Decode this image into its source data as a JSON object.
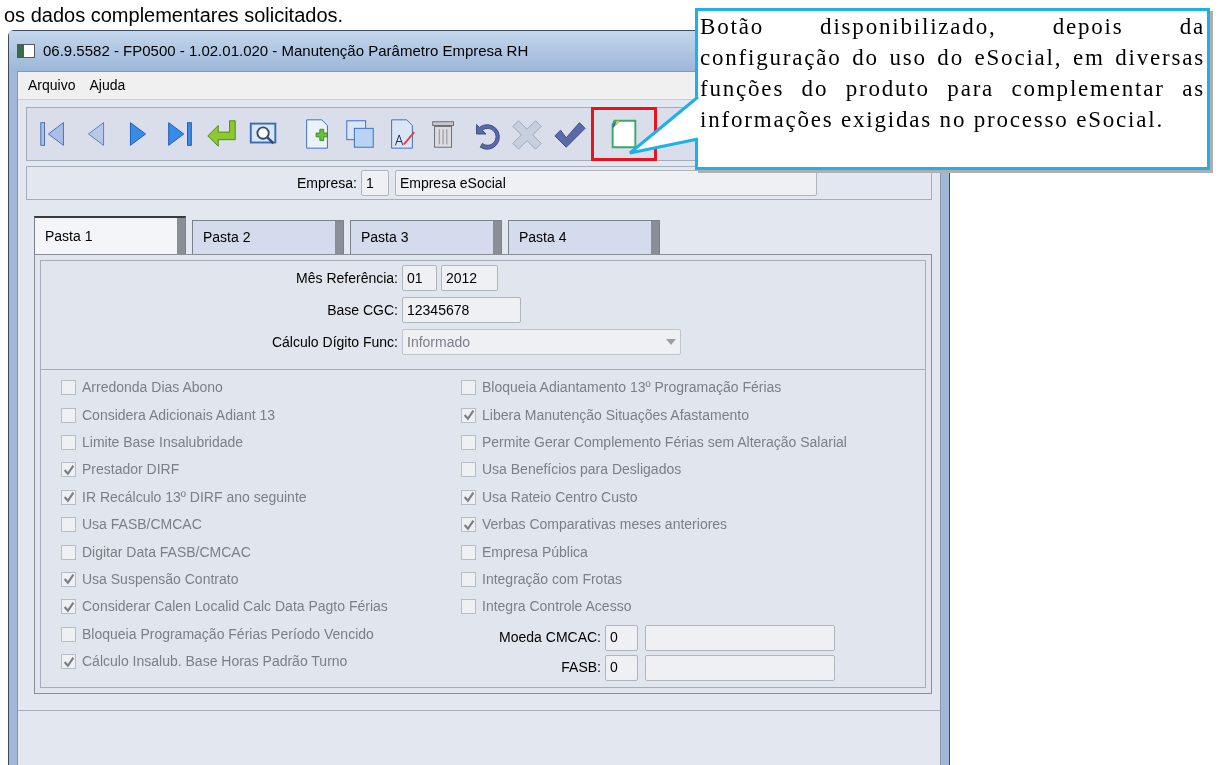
{
  "caption": "os dados complementares solicitados.",
  "window": {
    "title": "06.9.5582 - FP0500 - 1.02.01.020 - Manutenção Parâmetro Empresa RH"
  },
  "menu": [
    {
      "label": "Arquivo"
    },
    {
      "label": "Ajuda"
    }
  ],
  "toolbar": [
    {
      "kind": "first"
    },
    {
      "kind": "previous"
    },
    {
      "kind": "next"
    },
    {
      "kind": "last"
    },
    {
      "kind": "goto"
    },
    {
      "kind": "search"
    },
    {
      "kind": "new"
    },
    {
      "kind": "copy"
    },
    {
      "kind": "edit"
    },
    {
      "kind": "delete"
    },
    {
      "kind": "undo"
    },
    {
      "kind": "cancel"
    },
    {
      "kind": "save"
    },
    {
      "kind": "complement"
    }
  ],
  "empresa": {
    "label": "Empresa:",
    "code": "1",
    "name": "Empresa eSocial"
  },
  "tabs": [
    {
      "label": "Pasta 1",
      "selected": true
    },
    {
      "label": "Pasta 2",
      "selected": false
    },
    {
      "label": "Pasta 3",
      "selected": false
    },
    {
      "label": "Pasta 4",
      "selected": false
    }
  ],
  "mes_referencia": {
    "label": "Mês Referência:",
    "month": "01",
    "year": "2012"
  },
  "base_cgc": {
    "label": "Base CGC:",
    "value": "12345678"
  },
  "calculo_digito": {
    "label": "Cálculo Dígito Func:",
    "value": "Informado",
    "disabled": true
  },
  "left_options": [
    {
      "label": "Arredonda Dias Abono",
      "checked": false,
      "disabled": true
    },
    {
      "label": "Considera Adicionais Adiant 13",
      "checked": false,
      "disabled": true
    },
    {
      "label": "Limite Base Insalubridade",
      "checked": false,
      "disabled": true
    },
    {
      "label": "Prestador DIRF",
      "checked": true,
      "disabled": true
    },
    {
      "label": "IR Recálculo 13º DIRF ano seguinte",
      "checked": true,
      "disabled": true
    },
    {
      "label": "Usa FASB/CMCAC",
      "checked": false,
      "disabled": true
    },
    {
      "label": "Digitar Data FASB/CMCAC",
      "checked": false,
      "disabled": true
    },
    {
      "label": "Usa Suspensão Contrato",
      "checked": true,
      "disabled": true
    },
    {
      "label": "Considerar Calen Localid Calc Data Pagto Férias",
      "checked": true,
      "disabled": true
    },
    {
      "label": "Bloqueia Programação Férias Período Vencido",
      "checked": false,
      "disabled": true
    },
    {
      "label": "Cálculo Insalub. Base Horas Padrão Turno",
      "checked": true,
      "disabled": true
    }
  ],
  "right_options": [
    {
      "label": "Bloqueia Adiantamento 13º Programação Férias",
      "checked": false,
      "disabled": true
    },
    {
      "label": "Libera Manutenção Situações Afastamento",
      "checked": true,
      "disabled": true
    },
    {
      "label": "Permite Gerar Complemento Férias sem Alteração Salarial",
      "checked": false,
      "disabled": true
    },
    {
      "label": "Usa Benefícios para Desligados",
      "checked": false,
      "disabled": true
    },
    {
      "label": "Usa Rateio Centro Custo",
      "checked": true,
      "disabled": true
    },
    {
      "label": "Verbas Comparativas meses anteriores",
      "checked": true,
      "disabled": true
    },
    {
      "label": "Empresa Pública",
      "checked": false,
      "disabled": true
    },
    {
      "label": "Integração com Frotas",
      "checked": false,
      "disabled": true
    },
    {
      "label": "Integra Controle Acesso",
      "checked": false,
      "disabled": true
    }
  ],
  "code_fields": [
    {
      "label": "Moeda CMCAC:",
      "value": "0"
    },
    {
      "label": "FASB:",
      "value": "0"
    }
  ],
  "callout": {
    "highlight_frame": true,
    "text": "Botão disponibilizado, depois da configuração do uso do eSocial, em diversas funções do produto para complementar as informações exigidas no processo eSocial."
  }
}
